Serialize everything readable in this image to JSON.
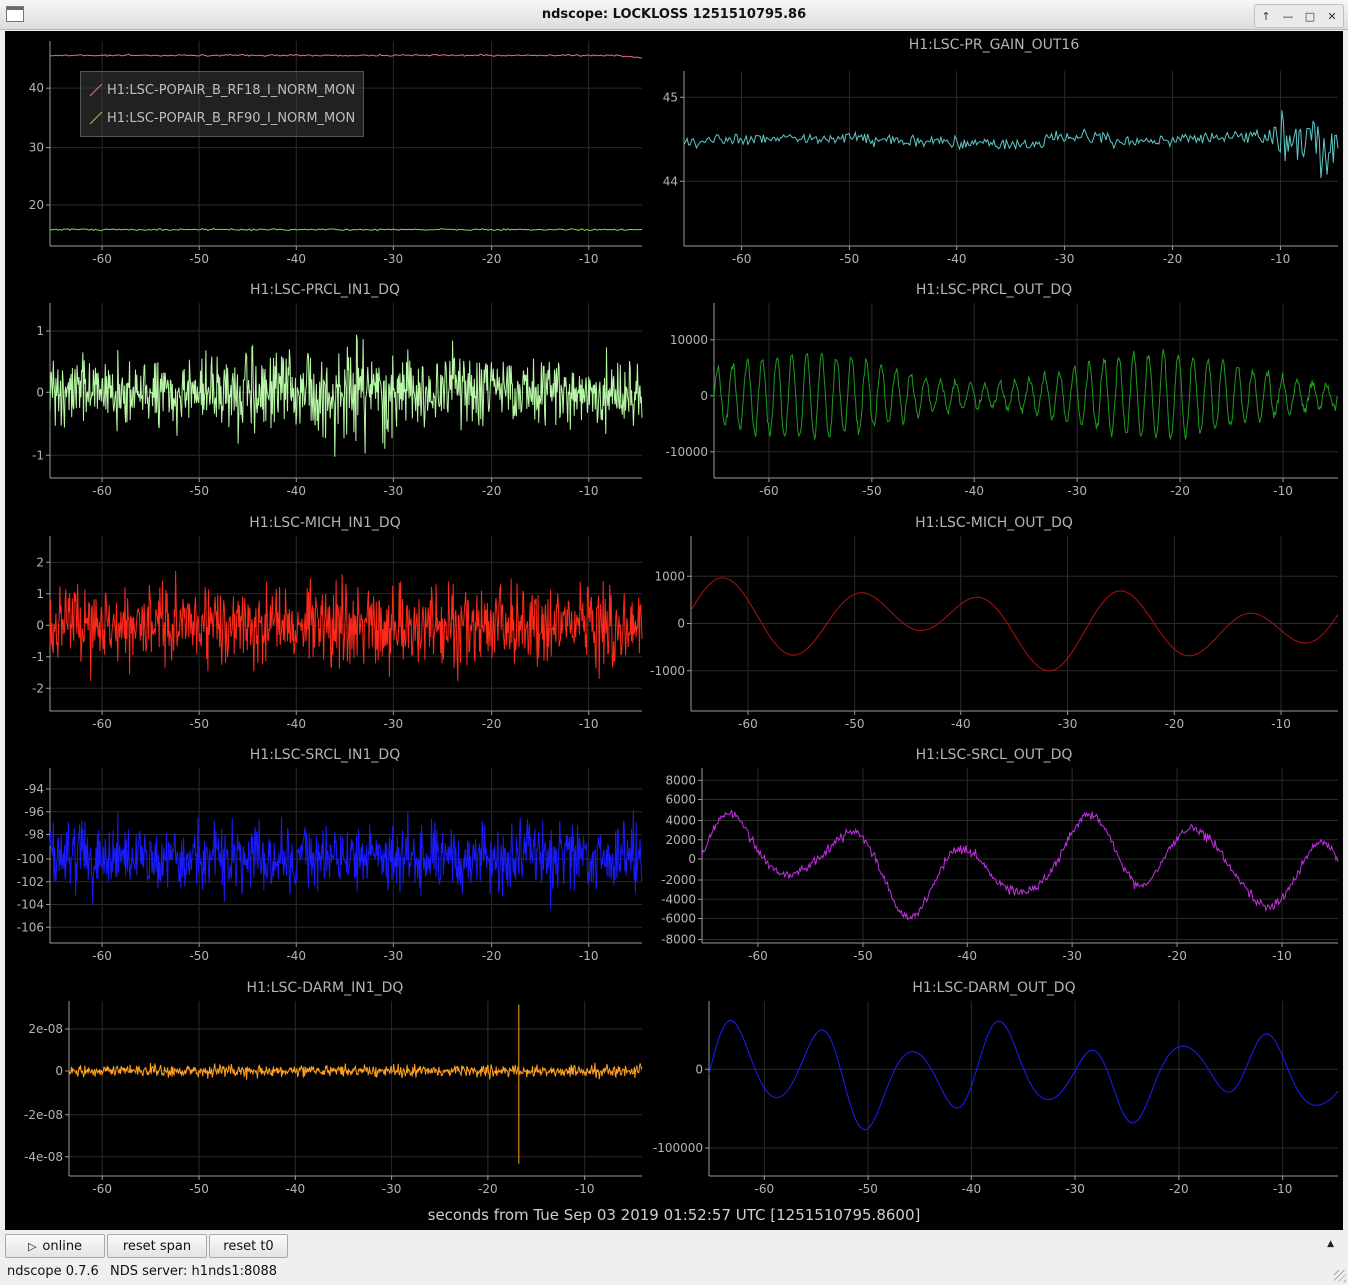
{
  "window": {
    "title": "ndscope: LOCKLOSS 1251510795.86"
  },
  "x_caption": "seconds from Tue Sep 03 2019 01:52:57 UTC [1251510795.8600]",
  "plots": [
    {
      "id": "p0",
      "title": "",
      "ylabels": [
        "40",
        "30",
        "20"
      ],
      "yticks": [
        40,
        30,
        20
      ],
      "xlabels": [
        "-60",
        "-50",
        "-40",
        "-30",
        "-20",
        "-10"
      ],
      "legend": [
        {
          "label": "H1:LSC-POPAIR_B_RF18_I_NORM_MON",
          "color": "#e86aa8"
        },
        {
          "label": "H1:LSC-POPAIR_B_RF90_I_NORM_MON",
          "color": "#78e04a"
        }
      ]
    },
    {
      "id": "p1",
      "title": "H1:LSC-PR_GAIN_OUT16",
      "ylabels": [
        "45",
        "44"
      ],
      "xlabels": [
        "-60",
        "-50",
        "-40",
        "-30",
        "-20",
        "-10"
      ],
      "color": "#5fc8c8"
    },
    {
      "id": "p2",
      "title": "H1:LSC-PRCL_IN1_DQ",
      "ylabels": [
        "1",
        "0",
        "-1"
      ],
      "xlabels": [
        "-60",
        "-50",
        "-40",
        "-30",
        "-20",
        "-10"
      ],
      "color": "#b8f7a6"
    },
    {
      "id": "p3",
      "title": "H1:LSC-PRCL_OUT_DQ",
      "ylabels": [
        "10000",
        "0",
        "-10000"
      ],
      "xlabels": [
        "-60",
        "-50",
        "-40",
        "-30",
        "-20",
        "-10"
      ],
      "color": "#1f9b1f"
    },
    {
      "id": "p4",
      "title": "H1:LSC-MICH_IN1_DQ",
      "ylabels": [
        "2",
        "1",
        "0",
        "-1",
        "-2"
      ],
      "xlabels": [
        "-60",
        "-50",
        "-40",
        "-30",
        "-20",
        "-10"
      ],
      "color": "#ff2a1a"
    },
    {
      "id": "p5",
      "title": "H1:LSC-MICH_OUT_DQ",
      "ylabels": [
        "1000",
        "0",
        "-1000"
      ],
      "xlabels": [
        "-60",
        "-50",
        "-40",
        "-30",
        "-20",
        "-10"
      ],
      "color": "#b01010"
    },
    {
      "id": "p6",
      "title": "H1:LSC-SRCL_IN1_DQ",
      "ylabels": [
        "-94",
        "-96",
        "-98",
        "-100",
        "-102",
        "-104",
        "-106"
      ],
      "xlabels": [
        "-60",
        "-50",
        "-40",
        "-30",
        "-20",
        "-10"
      ],
      "color": "#1a1aff"
    },
    {
      "id": "p7",
      "title": "H1:LSC-SRCL_OUT_DQ",
      "ylabels": [
        "8000",
        "6000",
        "4000",
        "2000",
        "0",
        "-2000",
        "-4000",
        "-6000",
        "-8000"
      ],
      "xlabels": [
        "-60",
        "-50",
        "-40",
        "-30",
        "-20",
        "-10"
      ],
      "color": "#c030e0"
    },
    {
      "id": "p8",
      "title": "H1:LSC-DARM_IN1_DQ",
      "ylabels": [
        "2e-08",
        "0",
        "-2e-08",
        "-4e-08"
      ],
      "xlabels": [
        "-60",
        "-50",
        "-40",
        "-30",
        "-20",
        "-10"
      ],
      "color": "#ffa020"
    },
    {
      "id": "p9",
      "title": "H1:LSC-DARM_OUT_DQ",
      "ylabels": [
        "0",
        "-100000"
      ],
      "xlabels": [
        "-60",
        "-50",
        "-40",
        "-30",
        "-20",
        "-10"
      ],
      "color": "#1a20ff"
    }
  ],
  "toolbar": {
    "online_label": "online",
    "reset_span_label": "reset span",
    "reset_t0_label": "reset t0"
  },
  "status": {
    "version": "ndscope 0.7.6",
    "server": "NDS server: h1nds1:8088"
  }
}
